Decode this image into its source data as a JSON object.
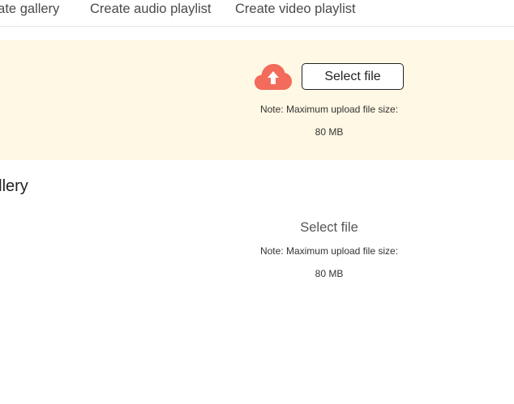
{
  "tabs": [
    {
      "label": "eate gallery"
    },
    {
      "label": "Create audio playlist"
    },
    {
      "label": "Create video playlist"
    }
  ],
  "upload_panel": {
    "button_label": "Select file",
    "note": "Note: Maximum upload file size:",
    "size": "80 MB",
    "icon": "cloud-upload-icon",
    "icon_color": "#f26b5b",
    "background": "#fff8e4"
  },
  "section": {
    "title": "allery"
  },
  "area2": {
    "select_label": "Select file",
    "note": "Note: Maximum upload file size:",
    "size": "80 MB"
  }
}
